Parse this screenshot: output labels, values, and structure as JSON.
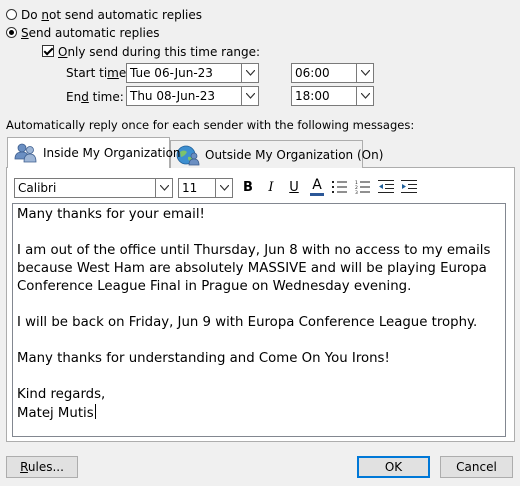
{
  "options": {
    "no_replies_label": "Do not send automatic replies",
    "no_replies_mnemonic": "n",
    "send_replies_label": "Send automatic replies",
    "send_replies_mnemonic": "S",
    "time_range_label": "Only send during this time range:",
    "time_range_mnemonic": "O"
  },
  "time_range": {
    "start_label_pre": "Start ti",
    "start_label_u": "m",
    "start_label_post": "e:",
    "start_date": "Tue 06-Jun-23",
    "start_time": "06:00",
    "end_label_pre": "En",
    "end_label_u": "d",
    "end_label_post": " time:",
    "end_date": "Thu 08-Jun-23",
    "end_time": "18:00"
  },
  "instructions": "Automatically reply once for each sender with the following messages:",
  "tabs": {
    "inside": "Inside My Organization",
    "outside": "Outside My Organization (On)"
  },
  "toolbar": {
    "font": "Calibri",
    "size": "11",
    "bold": "B",
    "italic": "I",
    "underline": "U",
    "font_color": "A"
  },
  "message": {
    "line1": "Many thanks for your email!",
    "line2": "I am out of the office until Thursday, Jun 8 with no access to my emails because West Ham are absolutely MASSIVE and will be playing Europa Conference League Final in Prague on Wednesday evening.",
    "line3": "I will be back on Friday, Jun 9 with Europa Conference League trophy.",
    "line4": "Many thanks for understanding and Come On You Irons!",
    "line5": "Kind regards,",
    "line6": "Matej Mutis"
  },
  "buttons": {
    "rules": "Rules...",
    "ok": "OK",
    "cancel": "Cancel"
  },
  "colors": {
    "accent": "#0078d7",
    "font_color_bar": "#2b5797"
  }
}
